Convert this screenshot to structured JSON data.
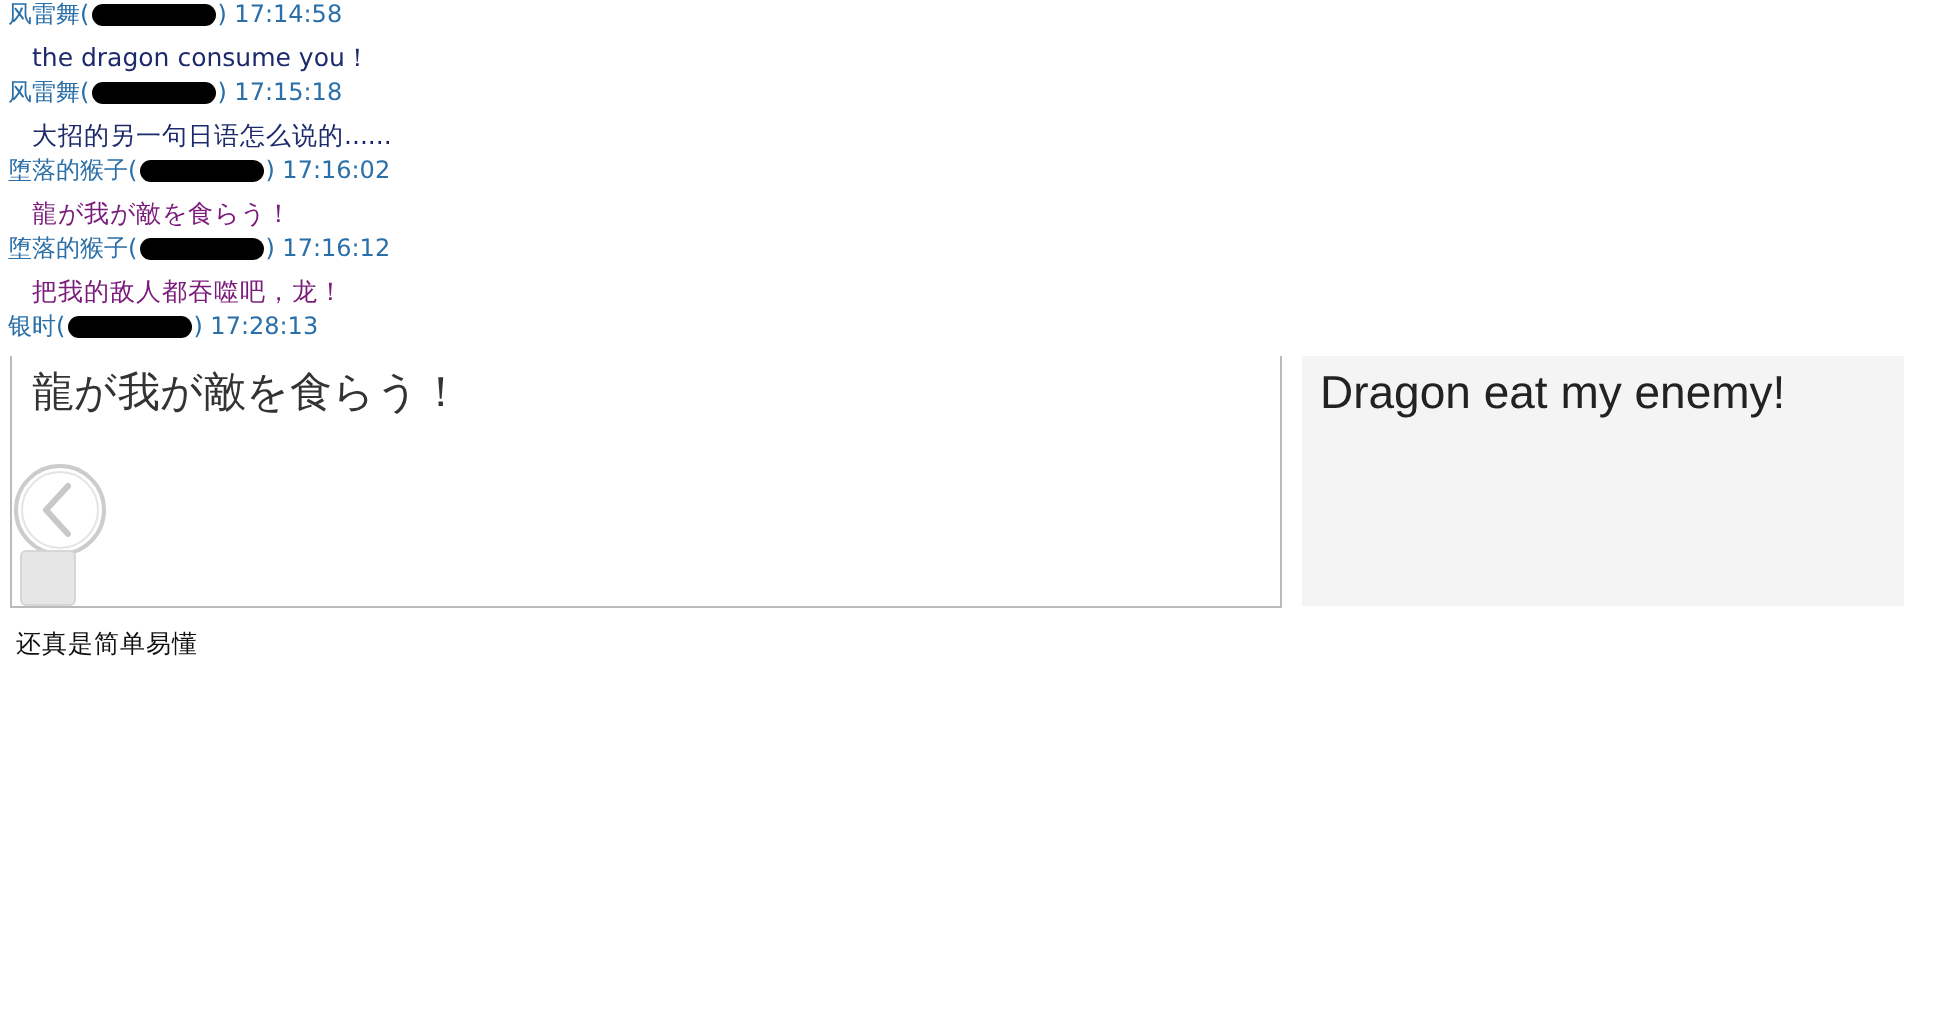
{
  "chat_log": [
    {
      "name": "风雷舞(",
      "time": ") 17:14:58",
      "message": "the dragon consume you！",
      "color": "#1c2a6b"
    },
    {
      "name": "风雷舞(",
      "time": ") 17:15:18",
      "message": "大招的另一句日语怎么说的......",
      "color": "#1c2a6b"
    },
    {
      "name": "堕落的猴子(",
      "time": ") 17:16:02",
      "message": "龍が我が敵を食らう！",
      "color": "#7a1a7a"
    },
    {
      "name": "堕落的猴子(",
      "time": ") 17:16:12",
      "message": "把我的敌人都吞噬吧，龙！",
      "color": "#7a1a7a"
    },
    {
      "name": "银时(",
      "time": ") 17:28:13"
    }
  ],
  "source_text": "龍が我が敵を食らう！",
  "translation": "Dragon eat my enemy!",
  "caption": "还真是简单易懂"
}
